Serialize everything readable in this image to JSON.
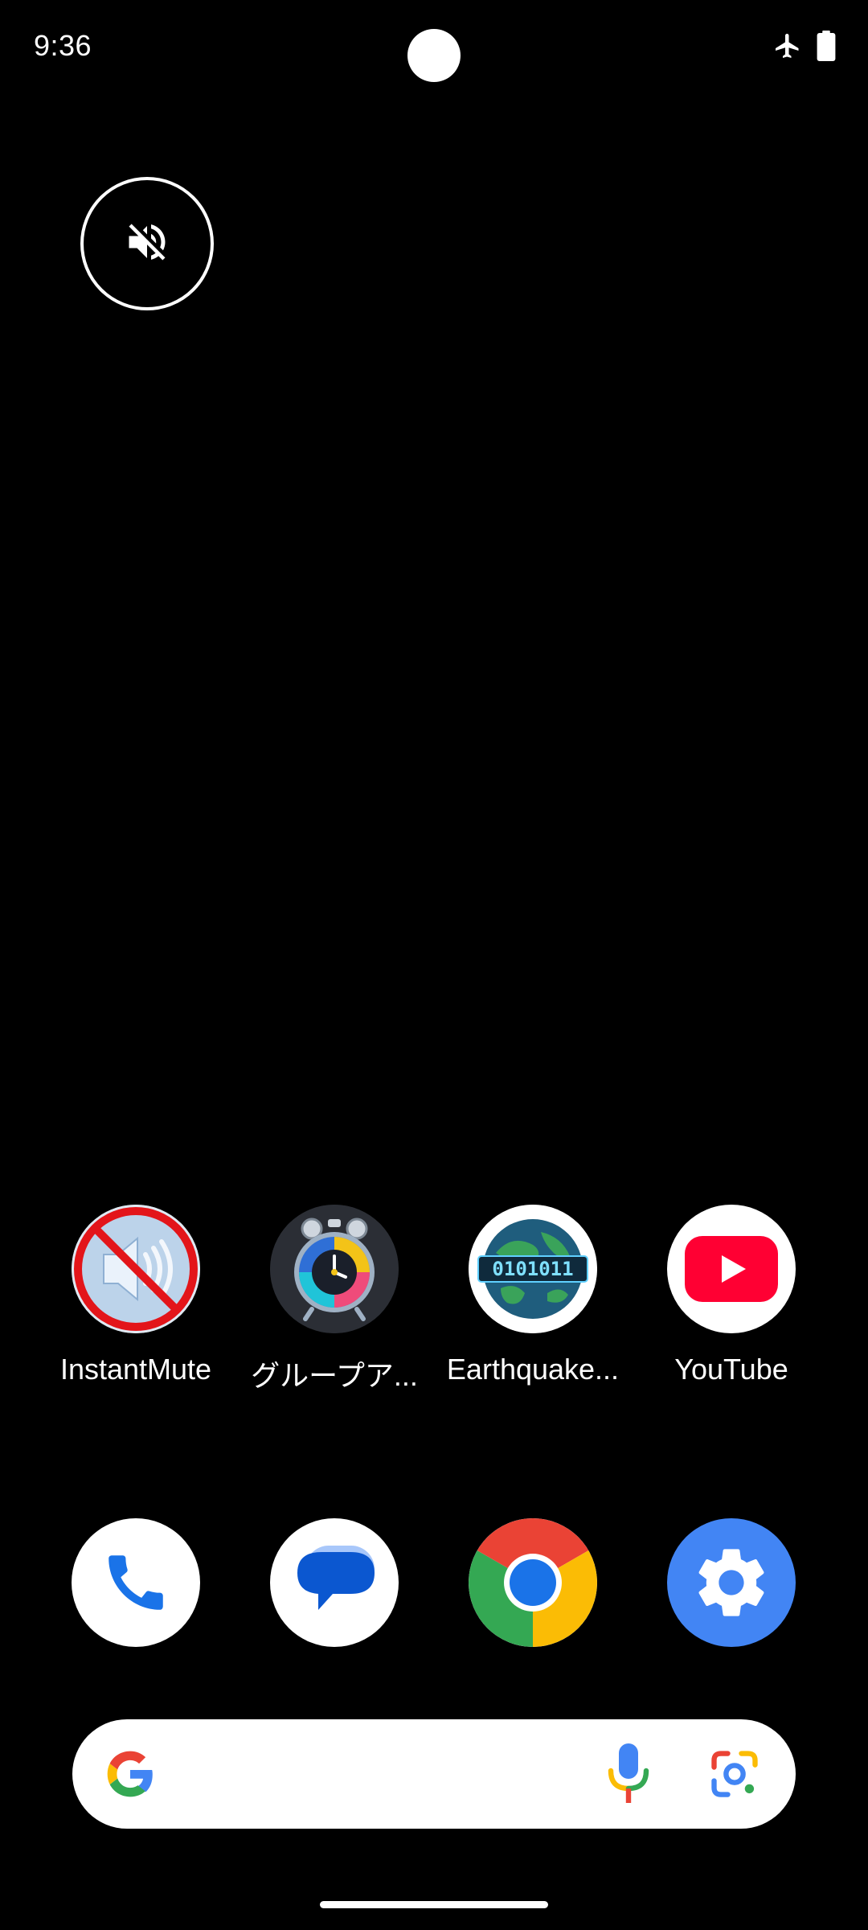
{
  "status_bar": {
    "time": "9:36",
    "icons": [
      "airplane-mode-icon",
      "battery-icon"
    ]
  },
  "floating_button": {
    "icon": "volume-off-icon"
  },
  "apps": [
    {
      "label": "InstantMute",
      "icon": "instantmute-icon"
    },
    {
      "label": "グループア...",
      "icon": "alarm-clock-icon"
    },
    {
      "label": "Earthquake...",
      "icon": "earth-binary-icon"
    },
    {
      "label": "YouTube",
      "icon": "youtube-icon"
    }
  ],
  "dock": [
    {
      "icon": "phone-icon"
    },
    {
      "icon": "messages-icon"
    },
    {
      "icon": "chrome-icon"
    },
    {
      "icon": "settings-icon"
    }
  ],
  "search_bar": {
    "icons": [
      "google-g-icon",
      "microphone-icon",
      "google-lens-icon"
    ]
  },
  "colors": {
    "background": "#000000",
    "youtube_red": "#ff0033",
    "google_blue": "#4285f4",
    "google_red": "#ea4335",
    "google_yellow": "#fbbc05",
    "google_green": "#34a853"
  }
}
